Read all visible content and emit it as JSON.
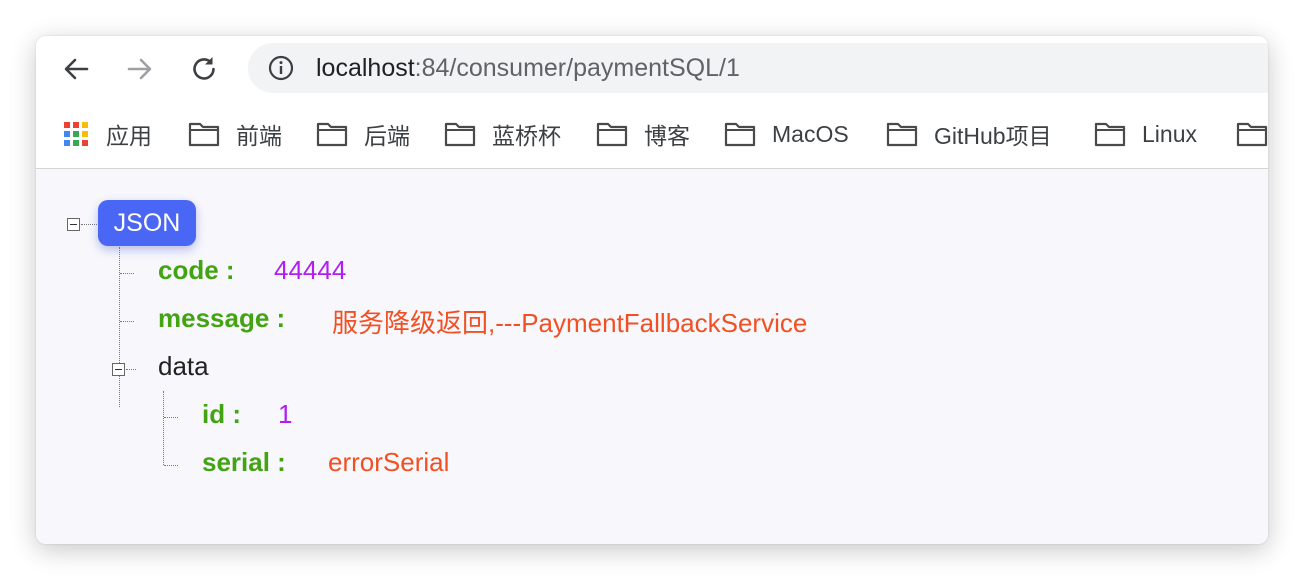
{
  "toolbar": {
    "back_icon": "arrow-left-icon",
    "forward_icon": "arrow-right-icon",
    "reload_icon": "reload-icon",
    "site_info_icon": "info-icon",
    "url_host": "localhost",
    "url_path": ":84/consumer/paymentSQL/1"
  },
  "bookmarks": {
    "apps_label": "应用",
    "items": [
      {
        "label": "前端",
        "icon": "folder-icon"
      },
      {
        "label": "后端",
        "icon": "folder-icon"
      },
      {
        "label": "蓝桥杯",
        "icon": "folder-icon"
      },
      {
        "label": "博客",
        "icon": "folder-icon"
      },
      {
        "label": "MacOS",
        "icon": "folder-icon"
      },
      {
        "label": "GitHub项目",
        "icon": "folder-icon"
      },
      {
        "label": "Linux",
        "icon": "folder-icon"
      },
      {
        "label": "",
        "icon": "folder-icon"
      }
    ]
  },
  "json_view": {
    "root_label": "JSON",
    "code_key": "code :",
    "code_value": "44444",
    "message_key": "message :",
    "message_value": "服务降级返回,---PaymentFallbackService",
    "data_key": "data",
    "id_key": "id :",
    "id_value": "1",
    "serial_key": "serial :",
    "serial_value": "errorSerial"
  },
  "colors": {
    "key": "#43a413",
    "number": "#b21ef0",
    "string": "#f15024",
    "badge": "#4a66f5"
  }
}
